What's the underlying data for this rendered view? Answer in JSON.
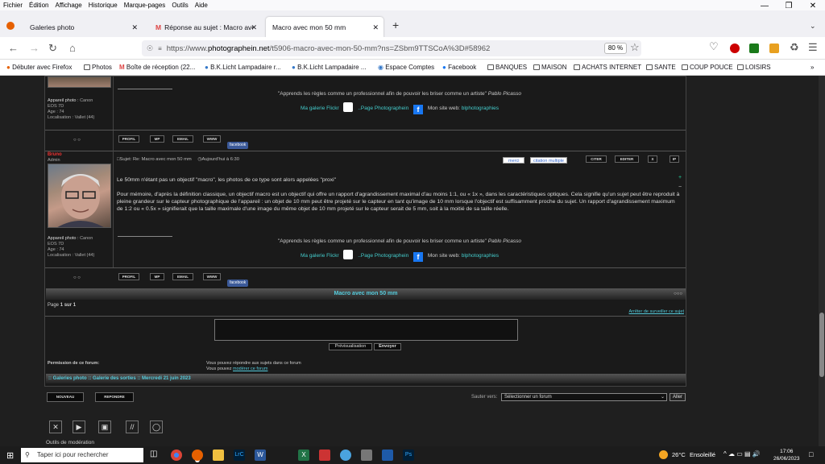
{
  "menu": [
    "Fichier",
    "Édition",
    "Affichage",
    "Historique",
    "Marque-pages",
    "Outils",
    "Aide"
  ],
  "tabs": [
    {
      "label": "Galeries photo"
    },
    {
      "label": "Réponse au sujet : Macro avec m"
    },
    {
      "label": "Macro avec mon 50 mm"
    }
  ],
  "url": {
    "prefix": "https://www.",
    "domain": "photographein.net",
    "rest": "/t5906-macro-avec-mon-50-mm?ns=ZSbm9TTSCoA%3D#58962"
  },
  "zoom": "80 %",
  "bookmarks": [
    "Débuter avec Firefox",
    "Photos",
    "Boîte de réception (22...",
    "B.K.Licht Lampadaire r...",
    "B.K.Licht Lampadaire ...",
    "Espace Comptes",
    "Facebook",
    "BANQUES",
    "MAISON",
    "ACHATS INTERNET",
    "SANTE",
    "COUP POUCE",
    "LOISIRS"
  ],
  "post1": {
    "profile": {
      "camera_label": "Appareil photo :",
      "camera_brand": "Canon",
      "camera_model": "EOS 7D",
      "age_label": "Age :",
      "age": "74",
      "loc_label": "Localisation :",
      "loc": "Vallet (44)"
    },
    "sig_quote": "\"Apprends les règles comme un professionnel afin de pouvoir les briser comme un artiste\"",
    "sig_author": "Pablo Picasso",
    "sig_gallery": "Ma galerie Flickr",
    "sig_page": "..Page Photographein",
    "sig_site_label": "Mon site web:",
    "sig_site": "blphotographies"
  },
  "post2": {
    "username": "Bruno",
    "rank": "Admin",
    "subject": "Sujet: Re: Macro avec mon 50 mm",
    "date": "Aujourd'hui à 6:30",
    "para1": "Le 50mm n'étant pas un objectif \"macro\", les photos de ce type sont alors appelées \"proxi\"",
    "para2": "Pour mémoire, d'après la définition classique, un objectif macro est un objectif qui offre un rapport d'agrandissement maximal d'au moins 1:1, ou « 1x », dans les caractéristiques optiques. Cela signifie qu'un sujet peut être reproduit à pleine grandeur sur le capteur photographique de l'appareil : un objet de 10 mm peut être projeté sur le capteur en tant qu'image de 10 mm lorsque l'objectif est suffisamment proche du sujet. Un rapport d'agrandissement maximum de 1:2 ou « 0.5x » signifierait que la taille maximale d'une image du même objet de 10 mm projeté sur le capteur serait de 5 mm, soit à la moitié de sa taille réelle.",
    "btn_merci": "merci",
    "btn_citation": "citation multiple",
    "btn_citer": "CITER",
    "btn_editer": "EDITER",
    "btn_x": "X",
    "btn_ip": "IP"
  },
  "actions": {
    "profil": "PROFIL",
    "mp": "MP",
    "email": "EMAIL",
    "www": "WWW",
    "facebook": "facebook"
  },
  "topic_title": "Macro avec mon 50 mm",
  "page_label": "Page",
  "page_info": "1 sur 1",
  "unwatch": "Arrêter de surveiller ce sujet",
  "preview_btn": "Prévisualisation",
  "send_btn": "Envoyer",
  "perm_label": "Permission de ce forum:",
  "perm_line1": "Vous pouvez répondre aux sujets dans ce forum",
  "perm_line2_pre": "Vous pouvez",
  "perm_line2_link": "modérer ce forum",
  "breadcrumb": ":: Galeries photo :: Galerie des sorties :: Mercredi 21 juin 2023",
  "btn_nouveau": "NOUVEAU",
  "btn_repondre": "REPONDRE",
  "jump_label": "Sauter vers:",
  "jump_select": "Sélectionner un forum",
  "jump_go": "Aller",
  "mod_tools": "Outils de modération",
  "taskbar": {
    "search": "Taper ici pour rechercher",
    "weather_temp": "26°C",
    "weather_desc": "Ensoleillé",
    "time": "17:06",
    "date": "26/06/2023"
  }
}
